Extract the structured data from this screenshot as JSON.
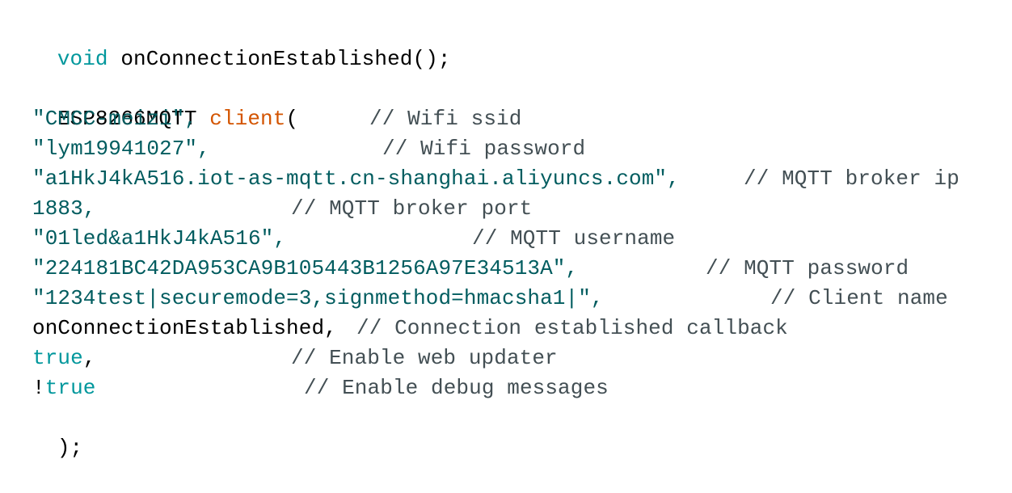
{
  "colors": {
    "keyword": "#00979c",
    "class_name": "#d35400",
    "string": "#005c5f",
    "comment": "#434f54",
    "plain": "#000000",
    "background": "#ffffff"
  },
  "code": {
    "line1": {
      "kw": "void",
      "rest": "onConnectionEstablished();"
    },
    "line3": {
      "type": "ESP8266MQTT",
      "obj": "client",
      "paren": "("
    },
    "args": {
      "ssid": {
        "value": "\"CMCC-meizi\",",
        "comment": "// Wifi ssid"
      },
      "wifi_pass": {
        "value": "\"lym19941027\",",
        "comment": "// Wifi password"
      },
      "broker": {
        "value": "\"a1HkJ4kA516.iot-as-mqtt.cn-shanghai.aliyuncs.com\",",
        "comment": "// MQTT broker ip"
      },
      "port": {
        "value": "1883,",
        "comment": "// MQTT broker port"
      },
      "user": {
        "value": "\"01led&a1HkJ4kA516\",",
        "comment": "// MQTT username"
      },
      "mqtt_pass": {
        "value": "\"224181BC42DA953CA9B105443B1256A97E34513A\",",
        "comment": "// MQTT password"
      },
      "client": {
        "value": "\"1234test|securemode=3,signmethod=hmacsha1|\",",
        "comment": "// Client name"
      },
      "callback": {
        "value": "onConnectionEstablished,",
        "comment": "// Connection established callback"
      },
      "web": {
        "kw": "true",
        "punct": ",",
        "comment": "// Enable web updater"
      },
      "debug": {
        "bang": "!",
        "kw": "true",
        "comment": "// Enable debug messages"
      }
    },
    "close": ");"
  }
}
